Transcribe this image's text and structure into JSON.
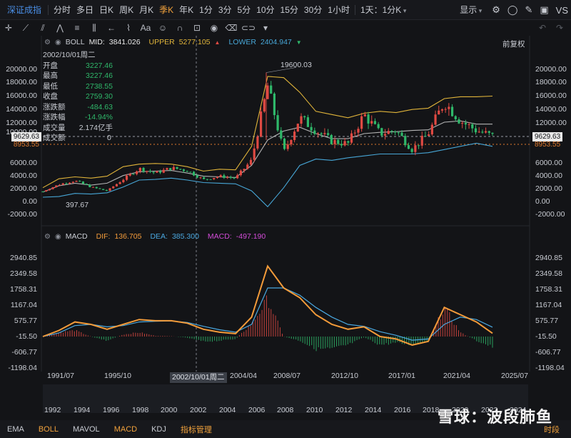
{
  "toolbar": {
    "symbol": "深证成指",
    "timeframes": [
      "分时",
      "多日",
      "日K",
      "周K",
      "月K",
      "季K",
      "年K",
      "1分",
      "3分",
      "5分",
      "10分",
      "15分",
      "30分",
      "1小时"
    ],
    "active_timeframe": "季K",
    "period_select": "1天：1分K",
    "display": "显示"
  },
  "main_chart": {
    "indicator": "BOLL",
    "mid_label": "MID:",
    "mid_value": "3841.026",
    "upper_label": "UPPER",
    "upper_value": "5277.105",
    "lower_label": "LOWER",
    "lower_value": "2404.947",
    "adjust": "前复权",
    "max_label": "19600.03",
    "min_label": "397.67",
    "crosshair_value": "0",
    "left_axis": [
      "20000.00",
      "18000.00",
      "16000.00",
      "14000.00",
      "12000.00",
      "10000.00",
      "9629.63",
      "8953.55",
      "6000.00",
      "4000.00",
      "2000.00",
      "0.00",
      "-2000.00"
    ],
    "right_axis": [
      "20000.00",
      "18000.00",
      "16000.00",
      "14000.00",
      "12000.00",
      "9629.63",
      "8953.55",
      "6000.00",
      "4000.00",
      "2000.00",
      "0.00",
      "-2000.00"
    ]
  },
  "info": {
    "date": "2002/10/01周二",
    "rows": [
      {
        "k": "开盘",
        "v": "3227.46"
      },
      {
        "k": "最高",
        "v": "3227.46"
      },
      {
        "k": "最低",
        "v": "2738.55"
      },
      {
        "k": "收盘",
        "v": "2759.30"
      },
      {
        "k": "涨跌额",
        "v": "-484.63"
      },
      {
        "k": "涨跌幅",
        "v": "-14.94%"
      },
      {
        "k": "成交量",
        "v": "2.174亿手"
      },
      {
        "k": "成交额",
        "v": ""
      }
    ]
  },
  "macd_chart": {
    "indicator": "MACD",
    "dif_label": "DIF:",
    "dif_value": "136.705",
    "dea_label": "DEA:",
    "dea_value": "385.300",
    "macd_label": "MACD:",
    "macd_value": "-497.190",
    "axis": [
      "2940.85",
      "2349.58",
      "1758.31",
      "1167.04",
      "575.77",
      "-15.50",
      "-606.77",
      "-1198.04"
    ]
  },
  "x_axis": [
    "1991/07",
    "1995/10",
    "2002/10/01周二",
    "2004/04",
    "2008/07",
    "2012/10",
    "2017/01",
    "2021/04",
    "2025/07"
  ],
  "navigator_years": [
    "1992",
    "1994",
    "1996",
    "1998",
    "2000",
    "2002",
    "2004",
    "2006",
    "2008",
    "2010",
    "2012",
    "2014",
    "2016",
    "2018",
    "2020",
    "2022",
    "2024"
  ],
  "indicators": [
    "EMA",
    "BOLL",
    "MAVOL",
    "MACD",
    "KDJ",
    "指标管理"
  ],
  "active_indicators": [
    "BOLL",
    "MACD"
  ],
  "bottom_right": "时段",
  "watermark": "雪球：波段肺鱼",
  "colors": {
    "up": "#e04a43",
    "down": "#2fb86a",
    "mid": "#e9e9e9",
    "upper": "#e0b43a",
    "lower": "#47a6d6",
    "dif": "#f39b3a",
    "dea": "#4aa8e0",
    "accent": "#f2a23c"
  },
  "chart_data": {
    "type": "line",
    "x": [
      "1991Q3",
      "1992Q3",
      "1993Q3",
      "1994Q3",
      "1995Q4",
      "1996Q4",
      "1997Q2",
      "1998Q4",
      "2000Q1",
      "2001Q2",
      "2002Q4",
      "2004Q2",
      "2005Q2",
      "2006Q3",
      "2007Q3",
      "2008Q4",
      "2009Q4",
      "2011Q1",
      "2012Q4",
      "2014Q2",
      "2015Q2",
      "2016Q2",
      "2017Q2",
      "2018Q4",
      "2019Q4",
      "2021Q1",
      "2022Q2",
      "2023Q2",
      "2024Q2"
    ],
    "series": [
      {
        "name": "close",
        "values": [
          900,
          2000,
          2600,
          1600,
          1000,
          2800,
          4500,
          3800,
          4600,
          4200,
          2759,
          3300,
          3000,
          5800,
          17500,
          7000,
          12500,
          10500,
          8800,
          8400,
          13000,
          10000,
          10500,
          7500,
          10000,
          15000,
          12000,
          10500,
          9629
        ]
      },
      {
        "name": "UPPER",
        "values": [
          1500,
          2900,
          3200,
          3000,
          3300,
          4800,
          5200,
          5300,
          5200,
          4800,
          4100,
          4400,
          4300,
          8000,
          19000,
          18800,
          16500,
          13500,
          13000,
          12500,
          13200,
          13500,
          13300,
          13800,
          14000,
          15500,
          15800,
          15800,
          15900
        ]
      },
      {
        "name": "MID",
        "values": [
          800,
          1800,
          2200,
          1900,
          2200,
          3400,
          4000,
          4100,
          4200,
          3800,
          3300,
          3200,
          3100,
          5000,
          9000,
          10400,
          11000,
          10000,
          9200,
          9200,
          10000,
          10200,
          10300,
          10500,
          10600,
          11800,
          12000,
          11500,
          11500
        ]
      },
      {
        "name": "LOWER",
        "values": [
          0,
          100,
          600,
          500,
          700,
          1600,
          2700,
          2800,
          3000,
          2700,
          2300,
          2200,
          2100,
          1000,
          -1500,
          1500,
          5000,
          6000,
          5800,
          6200,
          6500,
          6800,
          6800,
          6800,
          7000,
          7500,
          8000,
          8500,
          8000
        ]
      }
    ],
    "ylim": [
      -2000,
      20000
    ]
  }
}
